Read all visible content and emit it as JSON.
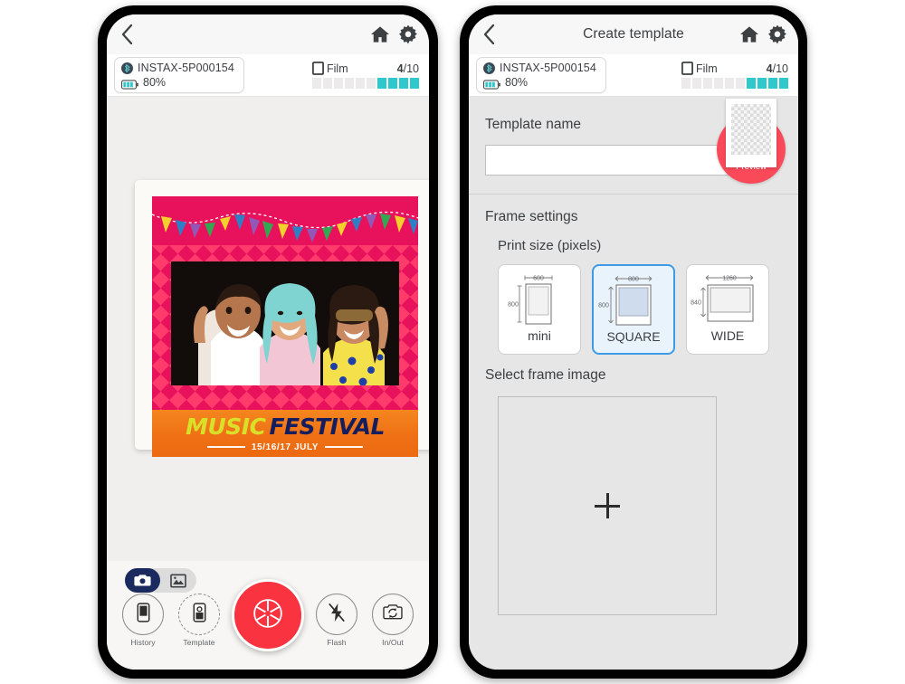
{
  "left_phone": {
    "nav": {
      "back_icon": "chevron-left-icon",
      "title": "",
      "home_icon": "home-icon",
      "settings_icon": "gear-icon"
    },
    "status": {
      "bluetooth_icon": "bluetooth-icon",
      "device_name": "INSTAX-5P000154",
      "battery_icon": "battery-icon",
      "battery_level": "80%",
      "film_icon": "film-icon",
      "film_label": "Film",
      "film_remaining": "4",
      "film_separator": "/10",
      "film_total_segments": 10,
      "film_filled_segments": 4,
      "film_fill_color": "#2ec8cd"
    },
    "preview_photo": {
      "title_part1": "MUSIC",
      "title_part2": "FESTIVAL",
      "date": "15/16/17 JULY",
      "frame_color": "#e8125c",
      "banner_color": "#ef7014",
      "title_color_1": "#d8e029",
      "title_color_2": "#141d5e"
    },
    "mode_toggle": {
      "camera_icon": "camera-icon",
      "gallery_icon": "image-icon",
      "active": "camera",
      "active_color": "#1b2a5e"
    },
    "controls": [
      {
        "name": "history",
        "label": "History",
        "icon": "phone-history-icon"
      },
      {
        "name": "template",
        "label": "Template",
        "icon": "phone-template-icon"
      },
      {
        "name": "flash",
        "label": "Flash",
        "icon": "flash-off-icon"
      },
      {
        "name": "inout",
        "label": "In/Out",
        "icon": "camera-flip-icon"
      }
    ],
    "shutter": {
      "icon": "aperture-icon",
      "color": "#f9333f"
    }
  },
  "right_phone": {
    "nav": {
      "back_icon": "chevron-left-icon",
      "title": "Create template",
      "home_icon": "home-icon",
      "settings_icon": "gear-icon"
    },
    "status": {
      "bluetooth_icon": "bluetooth-icon",
      "device_name": "INSTAX-5P000154",
      "battery_icon": "battery-icon",
      "battery_level": "80%",
      "film_icon": "film-icon",
      "film_label": "Film",
      "film_remaining": "4",
      "film_separator": "/10",
      "film_total_segments": 10,
      "film_filled_segments": 4,
      "film_fill_color": "#2ec8cd"
    },
    "template_name": {
      "label": "Template name",
      "value": "",
      "placeholder": ""
    },
    "preview_button": {
      "label": "Preview",
      "color": "#fa4a5a",
      "thumb_icon": "transparent-checker-thumbnail"
    },
    "frame_settings": {
      "section_label": "Frame settings",
      "print_size_label": "Print size (pixels)",
      "selected": "SQUARE",
      "selected_color": "#3f9ae5",
      "options": [
        {
          "name": "mini",
          "width": "600",
          "height": "800"
        },
        {
          "name": "SQUARE",
          "width": "800",
          "height": "800"
        },
        {
          "name": "WIDE",
          "width": "1260",
          "height": "840"
        }
      ]
    },
    "select_frame_image": {
      "label": "Select frame image",
      "add_icon": "plus-icon"
    }
  }
}
